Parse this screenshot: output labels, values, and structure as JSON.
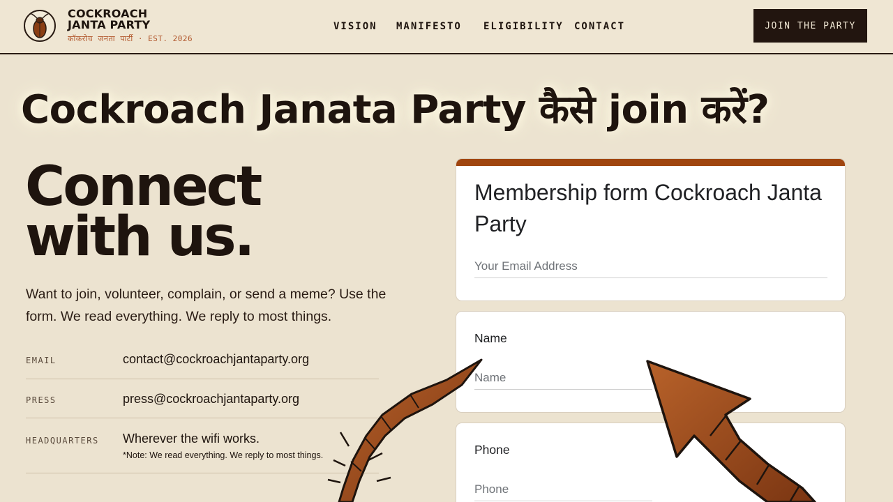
{
  "header": {
    "brand_line1": "COCKROACH",
    "brand_line2": "JANTA PARTY",
    "brand_sub": "कॉकरोच जनता पार्टी · EST. 2026",
    "logo_icon": "cockroach-logo-icon",
    "nav": [
      "VISION",
      "MANIFESTO",
      "ELIGIBILITY",
      "CONTACT"
    ],
    "join_button": "JOIN THE PARTY"
  },
  "headline": "Cockroach Janata Party कैसे join करें?",
  "left": {
    "title_line1": "Connect",
    "title_line2": "with us.",
    "intro": "Want to join, volunteer, complain, or send a meme? Use the form. We read everything. We reply to most things.",
    "rows": [
      {
        "label": "EMAIL",
        "value": "contact@cockroachjantaparty.org"
      },
      {
        "label": "PRESS",
        "value": "press@cockroachjantaparty.org"
      },
      {
        "label": "HEADQUARTERS",
        "value": "Wherever the wifi works.",
        "note": "*Note: We read everything. We reply to most things."
      }
    ]
  },
  "form": {
    "title": "Membership form Cockroach Janta Party",
    "email_placeholder": "Your Email Address",
    "name_label": "Name",
    "name_placeholder": "Name",
    "phone_label": "Phone",
    "phone_placeholder": "Phone"
  },
  "colors": {
    "background": "#ece3d0",
    "text": "#1e140e",
    "accent": "#a0450f",
    "button_bg": "#22150f",
    "brand_sub": "#b0552a"
  }
}
